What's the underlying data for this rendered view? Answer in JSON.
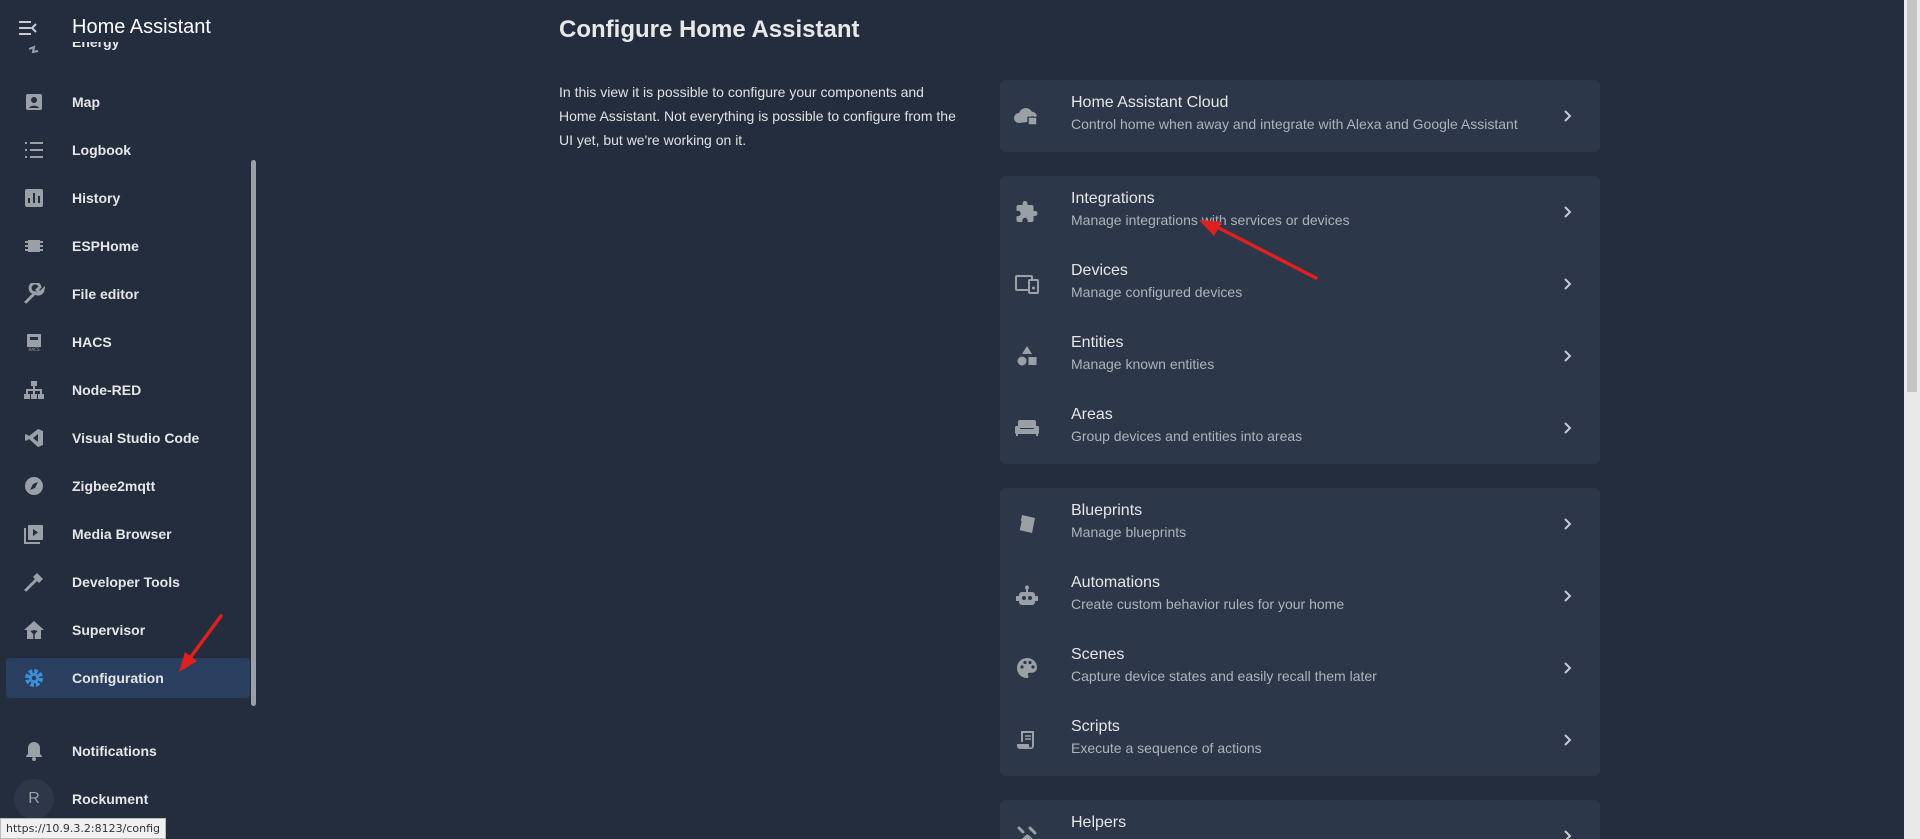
{
  "sidebar": {
    "app_title": "Home Assistant",
    "items": [
      {
        "label": "Energy",
        "icon": "energy-icon"
      },
      {
        "label": "Map",
        "icon": "map-icon"
      },
      {
        "label": "Logbook",
        "icon": "logbook-icon"
      },
      {
        "label": "History",
        "icon": "history-icon"
      },
      {
        "label": "ESPHome",
        "icon": "esphome-icon"
      },
      {
        "label": "File editor",
        "icon": "wrench-icon"
      },
      {
        "label": "HACS",
        "icon": "hacs-icon"
      },
      {
        "label": "Node-RED",
        "icon": "sitemap-icon"
      },
      {
        "label": "Visual Studio Code",
        "icon": "vscode-icon"
      },
      {
        "label": "Zigbee2mqtt",
        "icon": "compass-icon"
      },
      {
        "label": "Media Browser",
        "icon": "media-icon"
      },
      {
        "label": "Developer Tools",
        "icon": "hammer-icon"
      },
      {
        "label": "Supervisor",
        "icon": "home-assistant-icon"
      },
      {
        "label": "Configuration",
        "icon": "gear-icon",
        "active": true
      }
    ],
    "notifications": "Notifications",
    "user": "Rockument",
    "avatar_initial": "R"
  },
  "status_url": "https://10.9.3.2:8123/config",
  "main": {
    "title": "Configure Home Assistant",
    "intro": "In this view it is possible to configure your components and Home Assistant. Not everything is possible to configure from the UI yet, but we're working on it.",
    "cards": [
      [
        {
          "title": "Home Assistant Cloud",
          "sub": "Control home when away and integrate with Alexa and Google Assistant",
          "icon": "cloud-lock-icon"
        }
      ],
      [
        {
          "title": "Integrations",
          "sub": "Manage integrations with services or devices",
          "icon": "puzzle-icon"
        },
        {
          "title": "Devices",
          "sub": "Manage configured devices",
          "icon": "devices-icon"
        },
        {
          "title": "Entities",
          "sub": "Manage known entities",
          "icon": "shapes-icon"
        },
        {
          "title": "Areas",
          "sub": "Group devices and entities into areas",
          "icon": "sofa-icon"
        }
      ],
      [
        {
          "title": "Blueprints",
          "sub": "Manage blueprints",
          "icon": "blueprint-icon"
        },
        {
          "title": "Automations",
          "sub": "Create custom behavior rules for your home",
          "icon": "robot-icon"
        },
        {
          "title": "Scenes",
          "sub": "Capture device states and easily recall them later",
          "icon": "palette-icon"
        },
        {
          "title": "Scripts",
          "sub": "Execute a sequence of actions",
          "icon": "script-icon"
        }
      ],
      [
        {
          "title": "Helpers",
          "sub": "",
          "icon": "tools-icon"
        }
      ]
    ]
  },
  "colors": {
    "background": "#232d3e",
    "card": "#2c3749",
    "active_nav": "#2a3f5f",
    "accent": "#3a8fd6",
    "annotation": "#e01f1f"
  }
}
